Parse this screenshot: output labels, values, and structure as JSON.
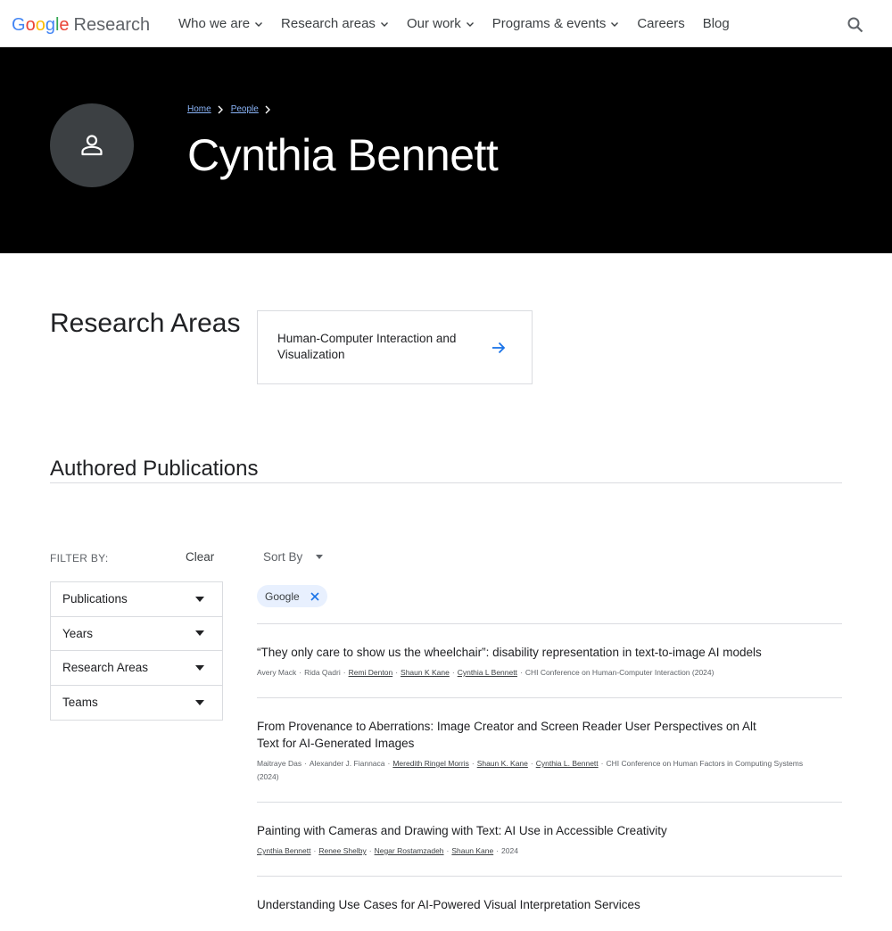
{
  "header": {
    "logo_google": [
      "G",
      "o",
      "o",
      "g",
      "l",
      "e"
    ],
    "logo_research": "Research",
    "nav": [
      {
        "label": "Who we are",
        "dropdown": true
      },
      {
        "label": "Research areas",
        "dropdown": true
      },
      {
        "label": "Our work",
        "dropdown": true
      },
      {
        "label": "Programs & events",
        "dropdown": true
      },
      {
        "label": "Careers",
        "dropdown": false
      },
      {
        "label": "Blog",
        "dropdown": false
      }
    ]
  },
  "hero": {
    "breadcrumb": [
      "Home",
      "People"
    ],
    "name": "Cynthia Bennett"
  },
  "research_areas": {
    "heading": "Research Areas",
    "cards": [
      "Human-Computer Interaction and Visualization"
    ]
  },
  "publications": {
    "heading": "Authored Publications",
    "filter_label": "FILTER BY:",
    "clear_label": "Clear",
    "filters": [
      "Publications",
      "Years",
      "Research Areas",
      "Teams"
    ],
    "sort_label": "Sort By",
    "chip_label": "Google",
    "items": [
      {
        "title": "“They only care to show us the wheelchair”: disability representation in text-to-image AI models",
        "authors": [
          {
            "name": "Avery Mack",
            "link": false
          },
          {
            "name": "Rida Qadri",
            "link": false
          },
          {
            "name": "Remi Denton",
            "link": true
          },
          {
            "name": "Shaun K Kane",
            "link": true
          },
          {
            "name": "Cynthia L Bennett",
            "link": true
          }
        ],
        "venue": "CHI Conference on Human-Computer Interaction (2024)"
      },
      {
        "title": "From Provenance to Aberrations: Image Creator and Screen Reader User Perspectives on Alt Text for AI-Generated Images",
        "authors": [
          {
            "name": "Maitraye Das",
            "link": false
          },
          {
            "name": "Alexander J. Fiannaca",
            "link": false
          },
          {
            "name": "Meredith Ringel Morris",
            "link": true
          },
          {
            "name": "Shaun K. Kane",
            "link": true
          },
          {
            "name": "Cynthia L. Bennett",
            "link": true
          }
        ],
        "venue": "CHI Conference on Human Factors in Computing Systems (2024)"
      },
      {
        "title": "Painting with Cameras and Drawing with Text: AI Use in Accessible Creativity",
        "authors": [
          {
            "name": "Cynthia Bennett",
            "link": true
          },
          {
            "name": "Renee Shelby",
            "link": true
          },
          {
            "name": "Negar Rostamzadeh",
            "link": true
          },
          {
            "name": "Shaun Kane",
            "link": true
          }
        ],
        "venue": "2024"
      },
      {
        "title": "Understanding Use Cases for AI-Powered Visual Interpretation Services",
        "authors": [],
        "venue": ""
      }
    ]
  },
  "colors": {
    "link_blue": "#1a73e8",
    "hero_bg": "#000000",
    "chip_bg": "#e8f0fe"
  }
}
